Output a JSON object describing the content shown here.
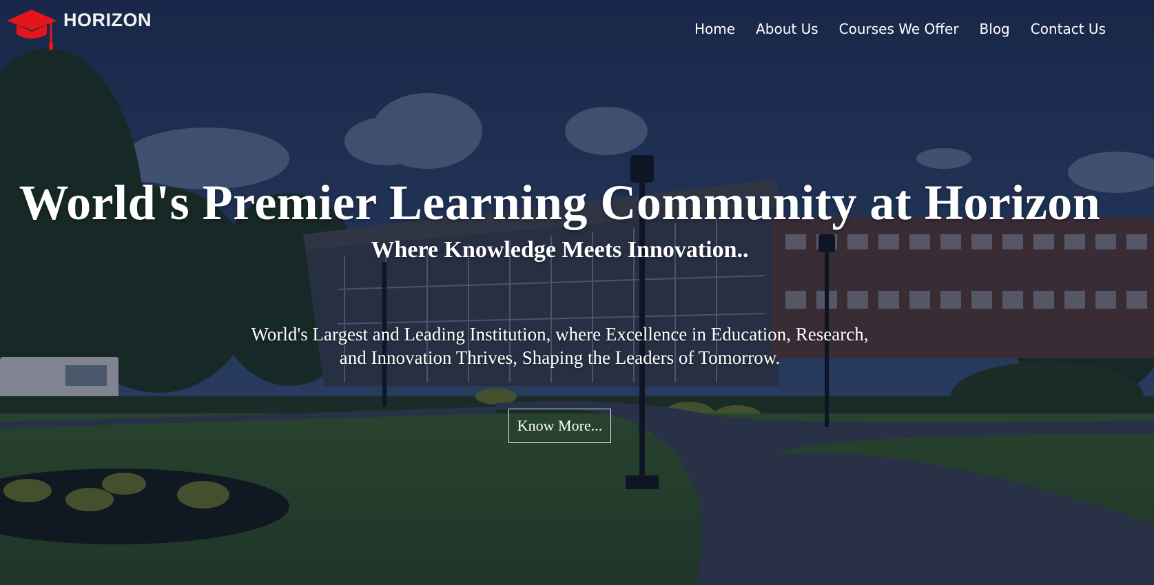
{
  "brand": {
    "name": "HORIZON",
    "logo_icon": "graduation-cap-icon",
    "logo_color": "#e5161b"
  },
  "nav": {
    "items": [
      {
        "label": "Home"
      },
      {
        "label": "About Us"
      },
      {
        "label": "Courses We Offer"
      },
      {
        "label": "Blog"
      },
      {
        "label": "Contact Us"
      }
    ]
  },
  "hero": {
    "title": "World's Premier Learning Community at Horizon",
    "subtitle": "Where Knowledge Meets Innovation..",
    "description": "World's Largest and Leading Institution, where Excellence in Education, Research, and Innovation Thrives, Shaping the Leaders of Tomorrow.",
    "cta_label": "Know More..."
  },
  "colors": {
    "text": "#ffffff",
    "sky": "#2a3d66",
    "grass": "#3f6a2c",
    "accent": "#e5161b"
  }
}
